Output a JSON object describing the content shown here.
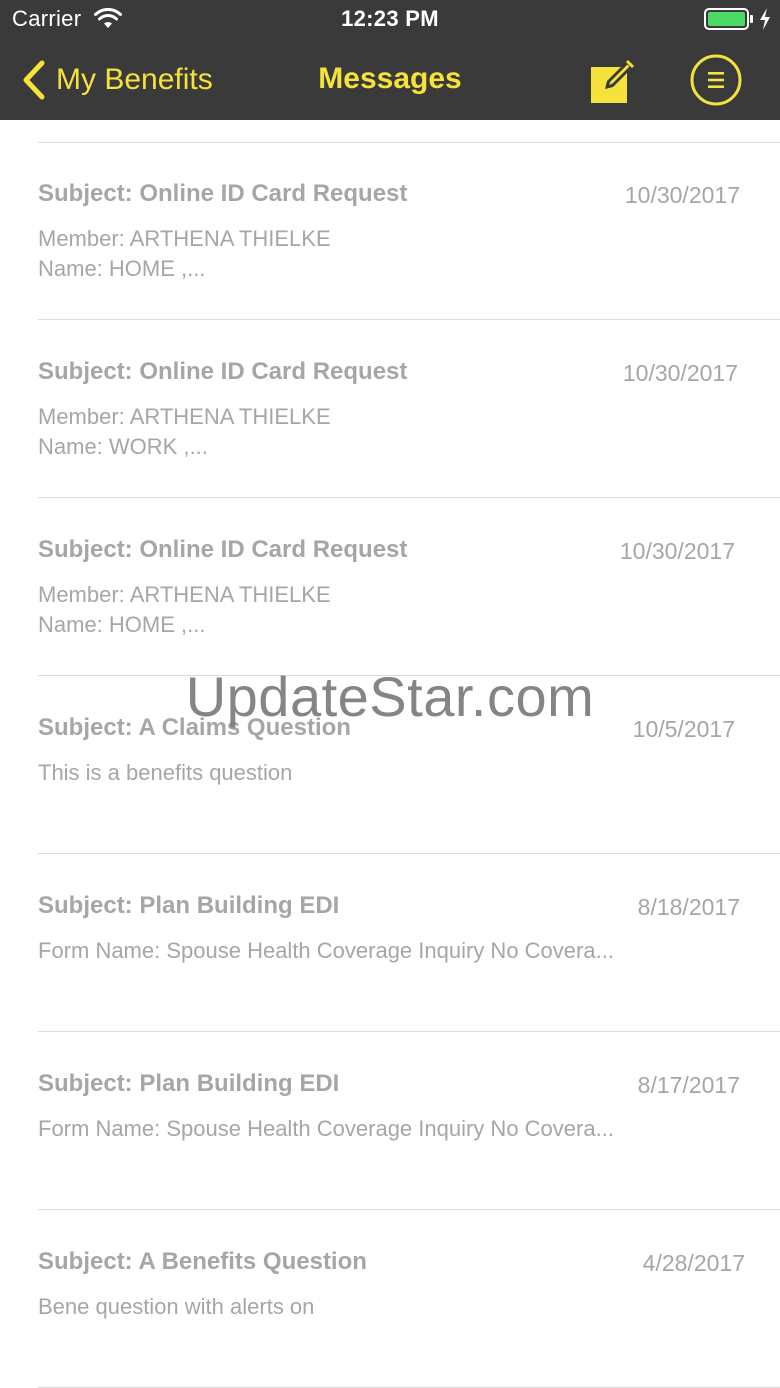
{
  "status_bar": {
    "carrier": "Carrier",
    "time": "12:23 PM",
    "battery_color": "#4cd964"
  },
  "nav": {
    "back_label": "My Benefits",
    "title": "Messages",
    "accent_color": "#f5e23a",
    "compose_icon": "compose-icon",
    "menu_icon": "menu-icon"
  },
  "messages": [
    {
      "subject": "Subject: Online ID Card Request",
      "date": "10/30/2017",
      "line1": "Member: ARTHENA THIELKE",
      "line2": "Name: HOME ,..."
    },
    {
      "subject": "Subject: Online ID Card Request",
      "date": "10/30/2017",
      "line1": "Member: ARTHENA THIELKE",
      "line2": "Name: WORK ,..."
    },
    {
      "subject": "Subject: Online ID Card Request",
      "date": "10/30/2017",
      "line1": "Member: ARTHENA THIELKE",
      "line2": "Name: HOME ,..."
    },
    {
      "subject": "Subject: A Claims Question",
      "date": "10/5/2017",
      "line1": "This is a benefits question",
      "line2": ""
    },
    {
      "subject": "Subject: Plan Building EDI",
      "date": "8/18/2017",
      "line1": "Form Name: Spouse Health Coverage Inquiry No Covera...",
      "line2": ""
    },
    {
      "subject": "Subject: Plan Building EDI",
      "date": "8/17/2017",
      "line1": "Form Name: Spouse Health Coverage Inquiry No Covera...",
      "line2": ""
    },
    {
      "subject": "Subject: A Benefits Question",
      "date": "4/28/2017",
      "line1": "Bene question with alerts on",
      "line2": ""
    }
  ],
  "watermark": "UpdateStar.com"
}
